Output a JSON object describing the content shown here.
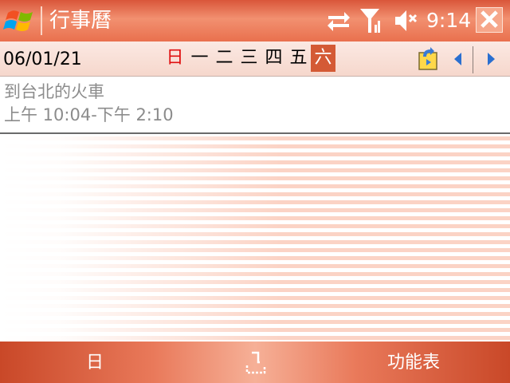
{
  "titlebar": {
    "app_title": "行事曆",
    "clock": "9:14",
    "icons": [
      "windows-start-icon",
      "sync-icon",
      "signal-icon",
      "volume-mute-icon",
      "close-icon"
    ]
  },
  "datebar": {
    "date": "06/01/21",
    "weekdays": [
      "日",
      "一",
      "二",
      "三",
      "四",
      "五",
      "六"
    ],
    "selected_index": 6,
    "icons": [
      "go-to-today-icon",
      "prev-arrow-icon",
      "next-arrow-icon"
    ]
  },
  "appointment": {
    "title": "到台北的火車",
    "time": "上午 10:04-下午 2:10"
  },
  "menubar": {
    "left_softkey": "日",
    "right_softkey": "功能表",
    "sip_icon": "keyboard-input-icon"
  },
  "colors": {
    "accent": "#d45a35",
    "titlebar": "#e9704e",
    "sunday": "#e01010"
  }
}
